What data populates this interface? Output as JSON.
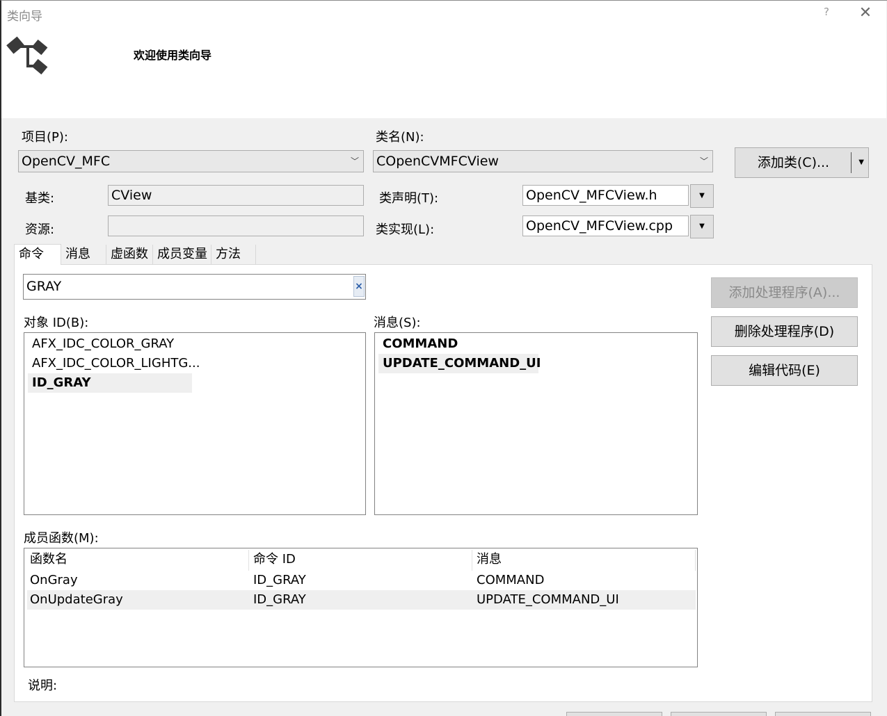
{
  "window": {
    "title": "类向导",
    "help": "?",
    "close": "✕",
    "welcome": "欢迎使用类向导"
  },
  "project": {
    "label": "项目(P):",
    "value": "OpenCV_MFC"
  },
  "classname": {
    "label": "类名(N):",
    "value": "COpenCVMFCView"
  },
  "add_class_button": "添加类(C)...",
  "base_class": {
    "label": "基类:",
    "value": "CView"
  },
  "resource": {
    "label": "资源:",
    "value": ""
  },
  "class_decl": {
    "label": "类声明(T):",
    "value": "OpenCV_MFCView.h"
  },
  "class_impl": {
    "label": "类实现(L):",
    "value": "OpenCV_MFCView.cpp"
  },
  "tabs": [
    "命令",
    "消息",
    "虚函数",
    "成员变量",
    "方法"
  ],
  "search": {
    "value": "GRAY",
    "clear": "×"
  },
  "object_ids": {
    "label": "对象 ID(B):",
    "items": [
      "AFX_IDC_COLOR_GRAY",
      "AFX_IDC_COLOR_LIGHTG...",
      "ID_GRAY"
    ],
    "selected_index": 2
  },
  "messages": {
    "label": "消息(S):",
    "items": [
      "COMMAND",
      "UPDATE_COMMAND_UI"
    ],
    "selected_index": 1
  },
  "actions": {
    "add_handler": "添加处理程序(A)...",
    "delete_handler": "删除处理程序(D)",
    "edit_code": "编辑代码(E)"
  },
  "member_functions": {
    "label": "成员函数(M):",
    "columns": [
      "函数名",
      "命令 ID",
      "消息"
    ],
    "rows": [
      [
        "OnGray",
        "ID_GRAY",
        "COMMAND"
      ],
      [
        "OnUpdateGray",
        "ID_GRAY",
        "UPDATE_COMMAND_UI"
      ]
    ],
    "selected_index": 1
  },
  "description": {
    "label": "说明:"
  },
  "colors": {
    "accent": "#2a5da8",
    "panel": "#ffffff",
    "chrome": "#f0f0f0"
  }
}
